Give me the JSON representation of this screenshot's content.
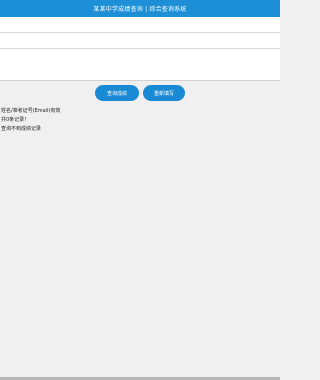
{
  "header": {
    "title": "某某中学成绩查询 | 综合查询系统",
    "color": "#1c8fd6"
  },
  "form": {
    "fields": [
      {
        "value": "",
        "placeholder": ""
      },
      {
        "value": "",
        "placeholder": ""
      }
    ]
  },
  "actions": {
    "query_label": "查询成绩",
    "reset_label": "重新填写"
  },
  "result": {
    "lines": [
      "姓名/准考证号(Email)有效",
      "共0条记录！",
      "查询不到成绩记录"
    ]
  }
}
